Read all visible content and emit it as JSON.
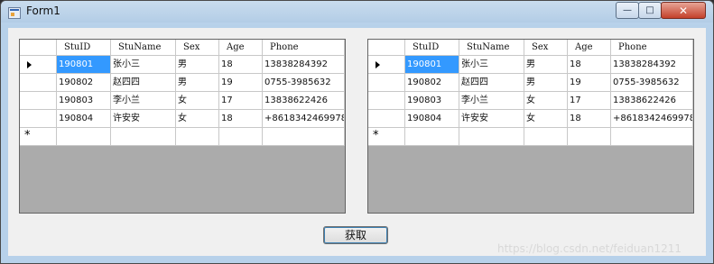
{
  "window": {
    "title": "Form1"
  },
  "controls": {
    "min": "—",
    "max": "□",
    "close": "✕"
  },
  "columns": [
    "StuID",
    "StuName",
    "Sex",
    "Age",
    "Phone"
  ],
  "rows": [
    [
      "190801",
      "张小三",
      "男",
      "18",
      "13838284392"
    ],
    [
      "190802",
      "赵四四",
      "男",
      "19",
      "0755-3985632"
    ],
    [
      "190803",
      "李小兰",
      "女",
      "17",
      "13838622426"
    ],
    [
      "190804",
      "许安安",
      "女",
      "18",
      "+8618342469978"
    ]
  ],
  "new_row_marker": "*",
  "button": {
    "label": "获取"
  },
  "watermark": "https://blog.csdn.net/feiduan1211"
}
